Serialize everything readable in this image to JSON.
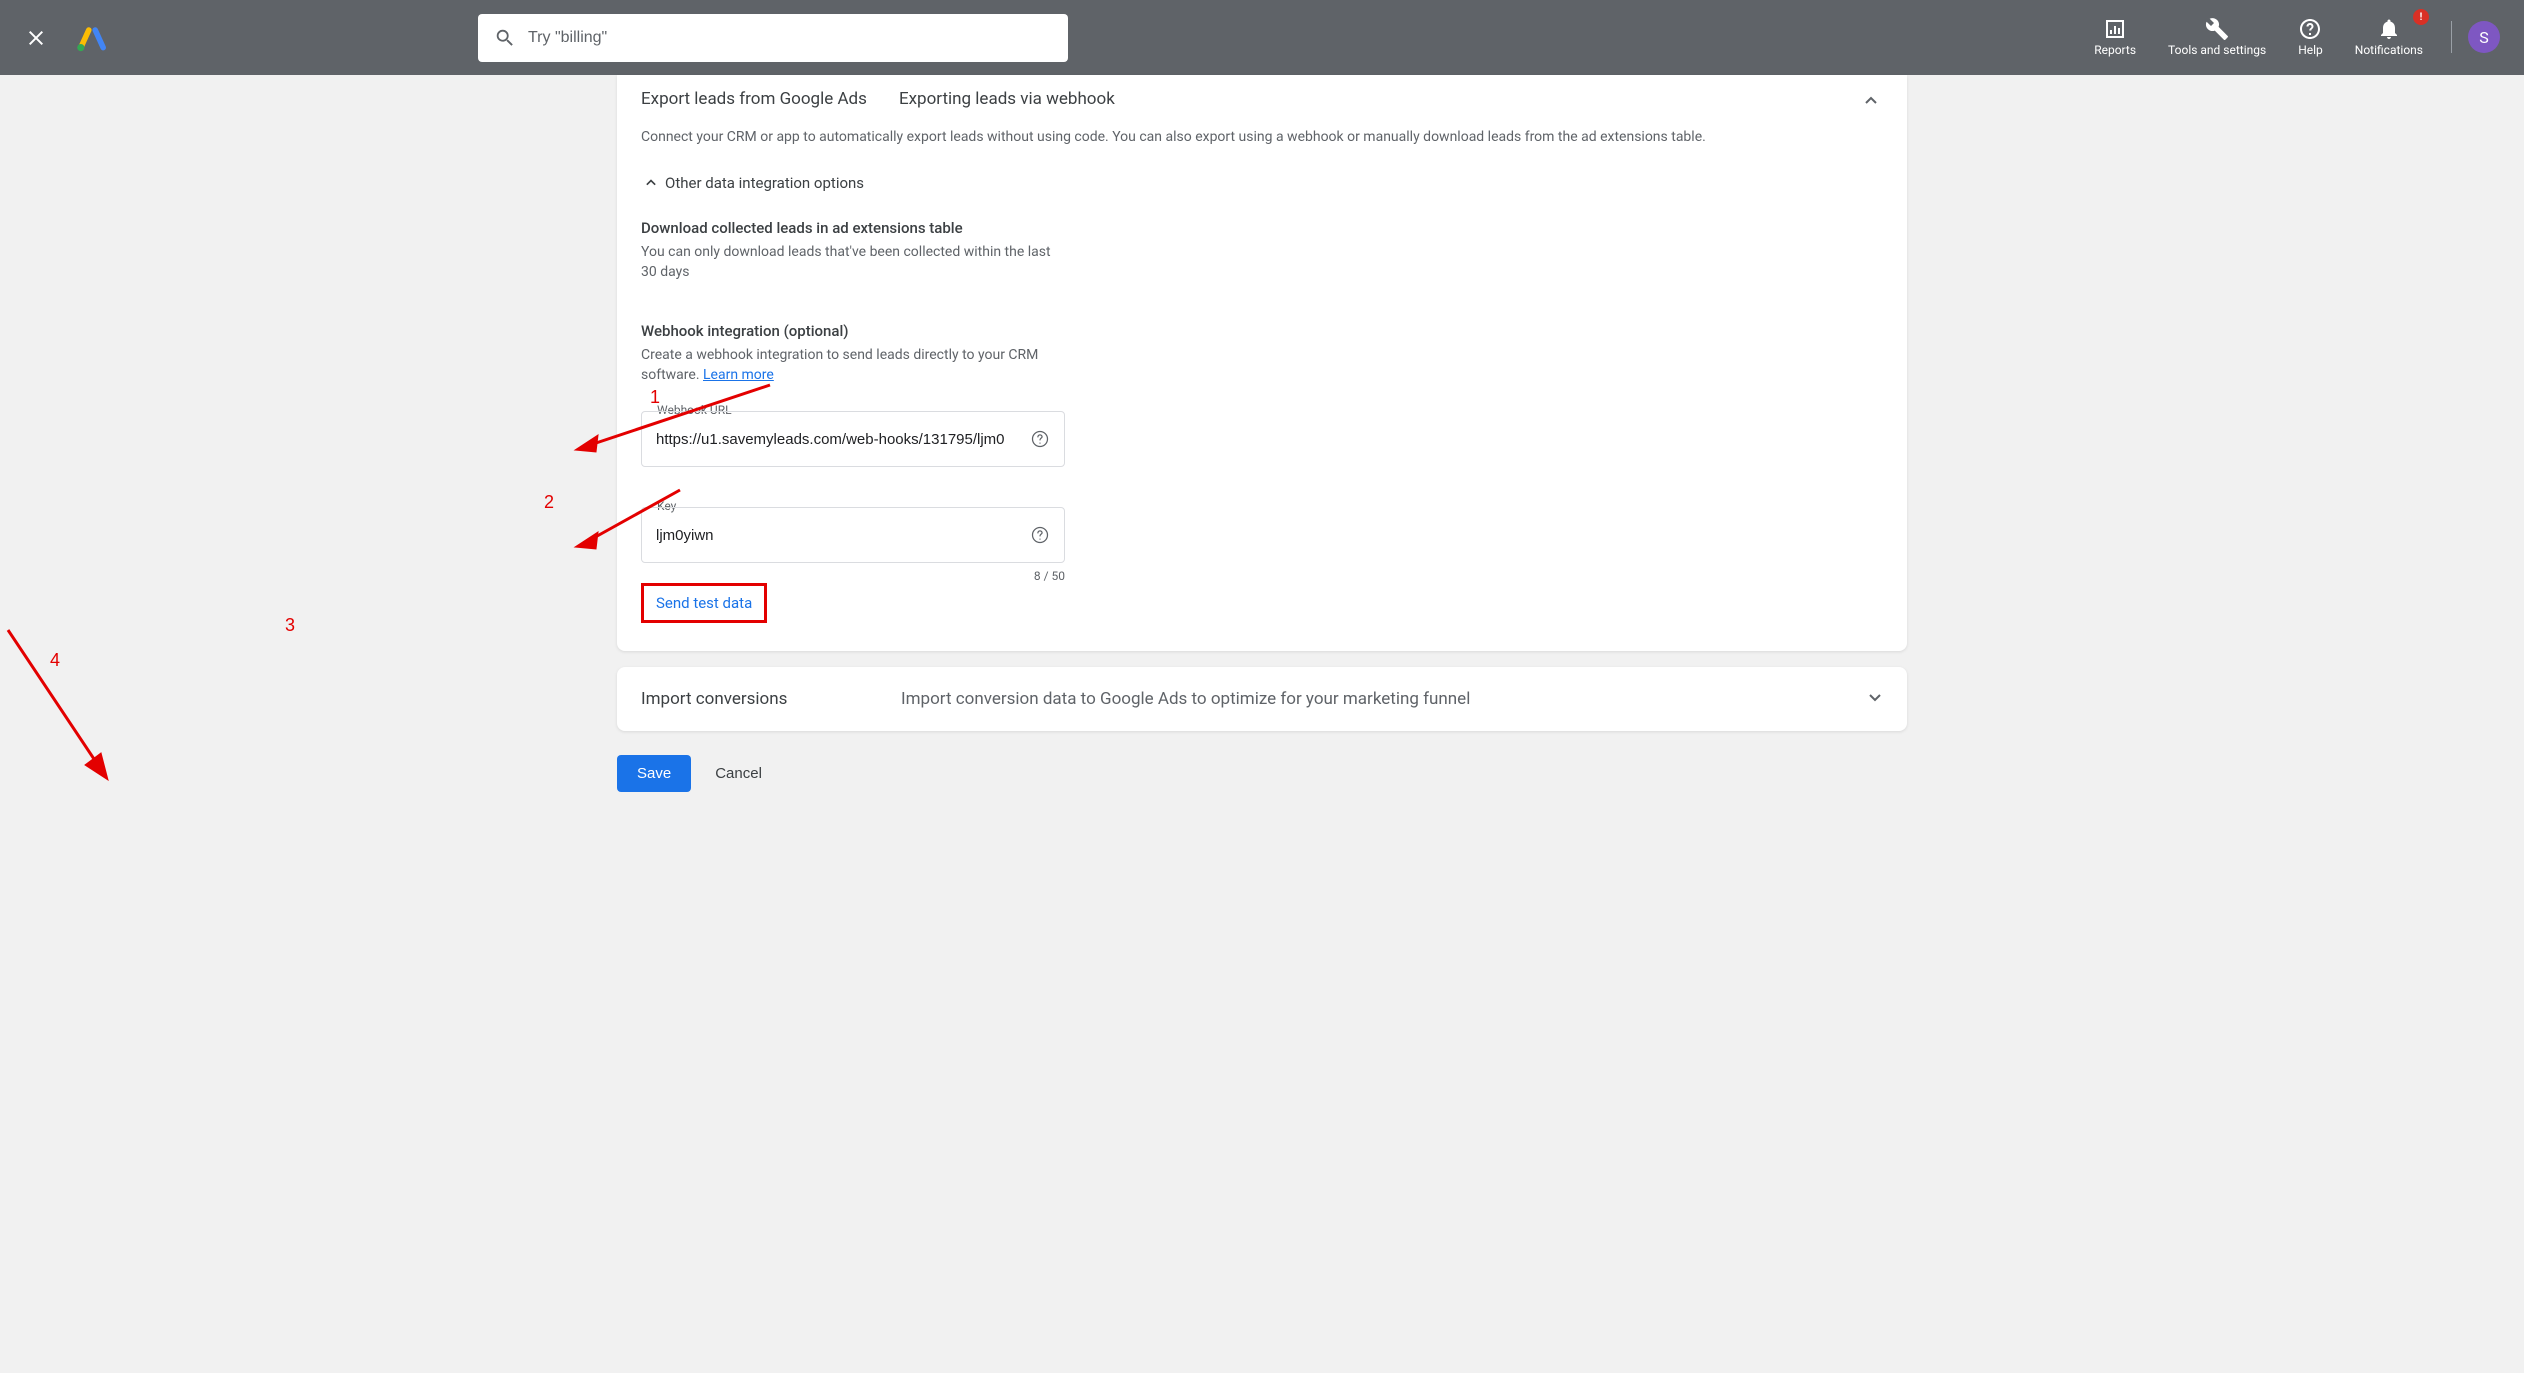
{
  "header": {
    "search_placeholder": "Try \"billing\"",
    "reports": "Reports",
    "tools": "Tools and settings",
    "help": "Help",
    "notifications": "Notifications",
    "notif_badge": "!",
    "avatar_initial": "S"
  },
  "card": {
    "title": "Export leads from Google Ads",
    "subtitle": "Exporting leads via webhook",
    "desc": "Connect your CRM or app to automatically export leads without using code. You can also export using a webhook or manually download leads from the ad extensions table.",
    "toggle_label": "Other data integration options",
    "download_head": "Download collected leads in ad extensions table",
    "download_text": "You can only download leads that've been collected within the last 30 days",
    "webhook_head": "Webhook integration (optional)",
    "webhook_text": "Create a webhook integration to send leads directly to your CRM software. ",
    "learn_more": "Learn more",
    "url_label": "Webhook URL",
    "url_value": "https://u1.savemyleads.com/web-hooks/131795/ljm0",
    "key_label": "Key",
    "key_value": "ljm0yiwn",
    "char_count": "8 / 50",
    "send_test": "Send test data"
  },
  "card2": {
    "title": "Import conversions",
    "desc": "Import conversion data to Google Ads to optimize for your marketing funnel"
  },
  "footer": {
    "save": "Save",
    "cancel": "Cancel"
  },
  "annotations": {
    "n1": "1",
    "n2": "2",
    "n3": "3",
    "n4": "4"
  }
}
